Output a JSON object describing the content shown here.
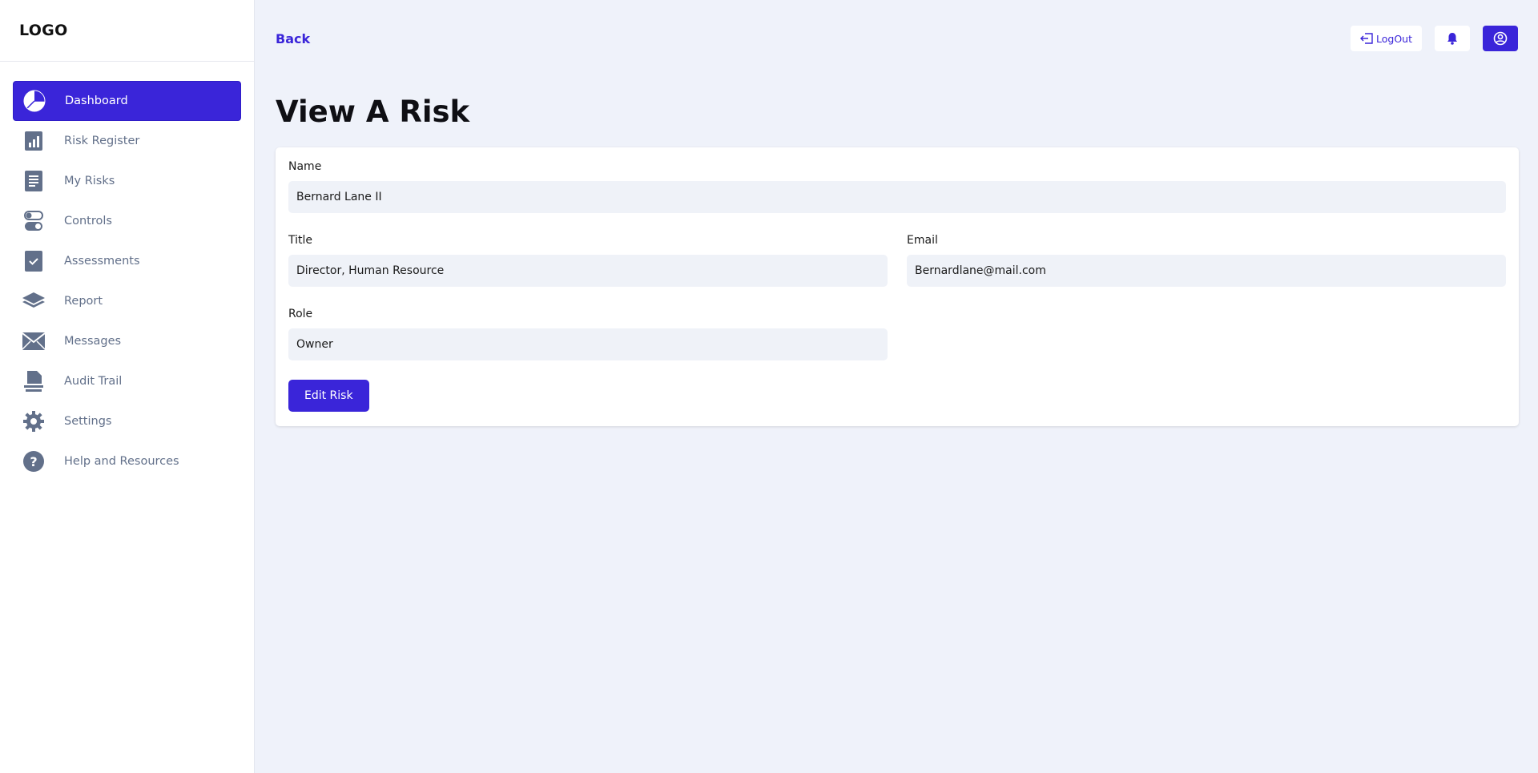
{
  "sidebar": {
    "logo": "LOGO",
    "items": [
      {
        "label": "Dashboard",
        "icon": "pie-chart-icon",
        "active": true
      },
      {
        "label": "Risk Register",
        "icon": "bar-chart-icon",
        "active": false
      },
      {
        "label": "My Risks",
        "icon": "document-icon",
        "active": false
      },
      {
        "label": "Controls",
        "icon": "toggle-icon",
        "active": false
      },
      {
        "label": "Assessments",
        "icon": "checkbox-icon",
        "active": false
      },
      {
        "label": "Report",
        "icon": "layers-icon",
        "active": false
      },
      {
        "label": "Messages",
        "icon": "envelope-icon",
        "active": false
      },
      {
        "label": "Audit Trail",
        "icon": "file-stack-icon",
        "active": false
      },
      {
        "label": "Settings",
        "icon": "gear-icon",
        "active": false
      },
      {
        "label": "Help and Resources",
        "icon": "question-icon",
        "active": false
      }
    ]
  },
  "header": {
    "back_label": "Back",
    "logout_label": "LogOut"
  },
  "page": {
    "title": "View A Risk"
  },
  "form": {
    "name_label": "Name",
    "name_value": "Bernard Lane II",
    "title_label": "Title",
    "title_value": "Director, Human Resource",
    "email_label": "Email",
    "email_value": "Bernardlane@mail.com",
    "role_label": "Role",
    "role_value": "Owner",
    "edit_button": "Edit Risk"
  },
  "colors": {
    "accent": "#3a25d9",
    "sidebar_icon": "#62708a",
    "background": "#eff2fa"
  }
}
